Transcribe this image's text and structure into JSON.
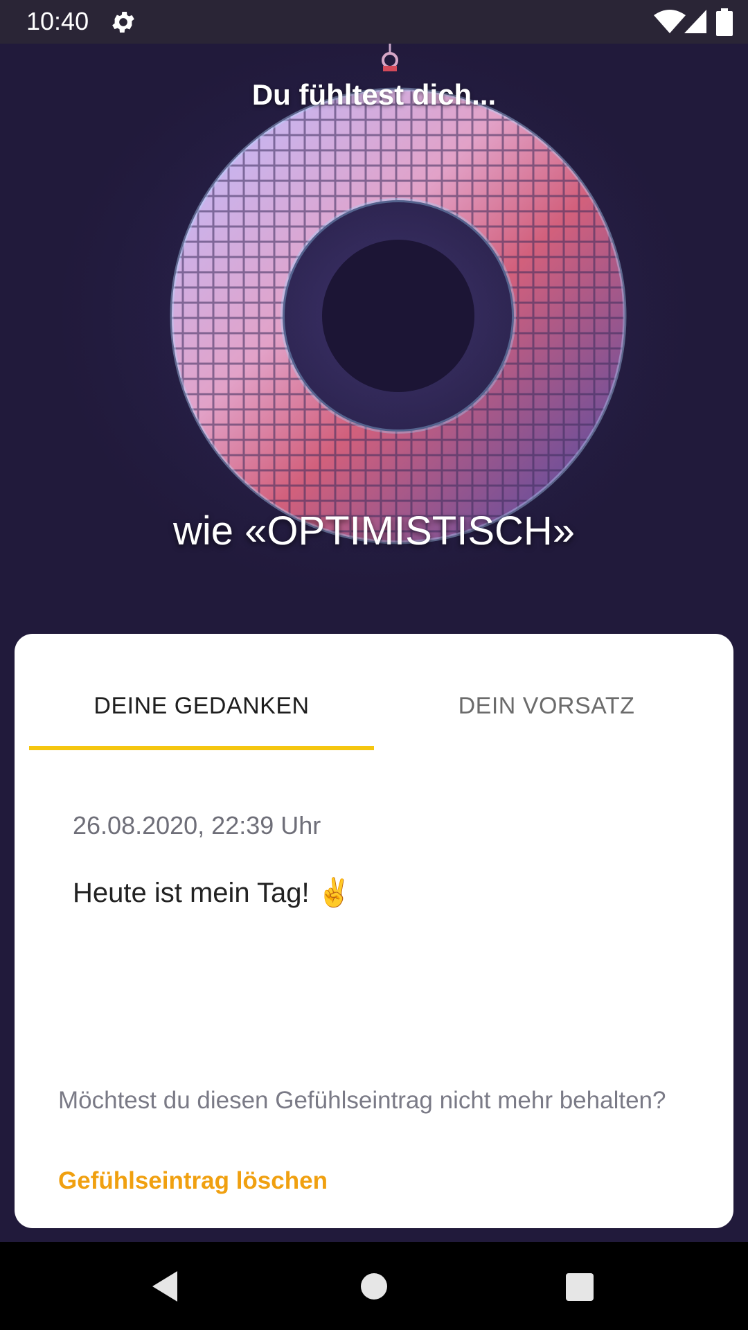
{
  "status_bar": {
    "time": "10:40",
    "icons": [
      "gear-icon",
      "wifi-icon",
      "cell-signal-icon",
      "battery-icon"
    ]
  },
  "hero": {
    "title": "Du fühltest dich...",
    "mood": "wie «OPTIMISTISCH»",
    "image": "disco-ball-donut"
  },
  "card": {
    "tabs": [
      {
        "label": "DEINE GEDANKEN",
        "active": true
      },
      {
        "label": "DEIN VORSATZ",
        "active": false
      }
    ],
    "entry": {
      "date": "26.08.2020, 22:39 Uhr",
      "text": "Heute ist mein Tag!",
      "emoji": "✌"
    },
    "delete_question": "Möchtest du diesen Gefühlseintrag nicht mehr behalten?",
    "delete_link": "Gefühlseintrag löschen"
  },
  "nav_bar": {
    "icons": [
      "back-icon",
      "home-icon",
      "recents-icon"
    ]
  },
  "colors": {
    "background": "#211a3b",
    "accent": "#f5c60f",
    "link": "#f0a010"
  }
}
